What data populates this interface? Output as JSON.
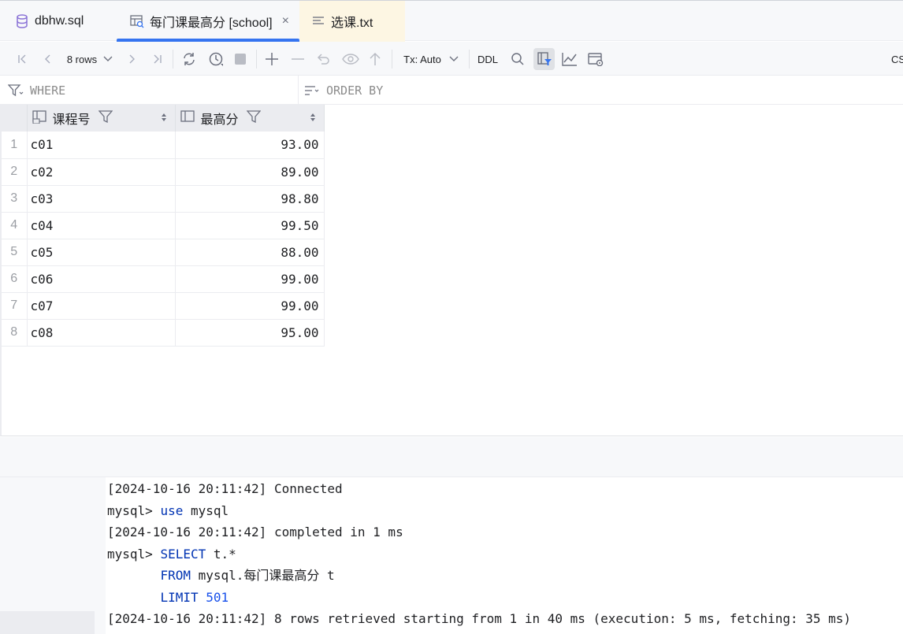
{
  "tabs": [
    {
      "label": "dbhw.sql",
      "icon": "database-icon"
    },
    {
      "label": "每门课最高分 [school]",
      "icon": "table-view-icon",
      "active": true
    },
    {
      "label": "选课.txt",
      "icon": "text-file-icon"
    }
  ],
  "toolbar": {
    "rows_label": "8 rows",
    "tx_label": "Tx: Auto",
    "ddl_label": "DDL",
    "cut_label": "CS"
  },
  "filters": {
    "where_label": "WHERE",
    "order_label": "ORDER BY"
  },
  "grid": {
    "columns": [
      "课程号",
      "最高分"
    ],
    "rows": [
      {
        "n": "1",
        "course": "c01",
        "score": "93.00"
      },
      {
        "n": "2",
        "course": "c02",
        "score": "89.00"
      },
      {
        "n": "3",
        "course": "c03",
        "score": "98.80"
      },
      {
        "n": "4",
        "course": "c04",
        "score": "99.50"
      },
      {
        "n": "5",
        "course": "c05",
        "score": "88.00"
      },
      {
        "n": "6",
        "course": "c06",
        "score": "99.00"
      },
      {
        "n": "7",
        "course": "c07",
        "score": "99.00"
      },
      {
        "n": "8",
        "course": "c08",
        "score": "95.00"
      }
    ]
  },
  "console": {
    "l1_ts": "[2024-10-16 20:11:42]",
    "l1_msg": "Connected",
    "l2_prompt": "mysql>",
    "l2_kw": "use",
    "l2_rest": "mysql",
    "l3_ts": "[2024-10-16 20:11:42]",
    "l3_msg": "completed in 1 ms",
    "l4_prompt": "mysql>",
    "l4_kw": "SELECT",
    "l4_rest": "t.*",
    "l5_kw": "FROM",
    "l5_rest": "mysql.每门课最高分 t",
    "l6_kw": "LIMIT",
    "l6_num": "501",
    "l7_ts": "[2024-10-16 20:11:42]",
    "l7_msg": "8 rows retrieved starting from 1 in 40 ms (execution: 5 ms, fetching: 35 ms)"
  }
}
